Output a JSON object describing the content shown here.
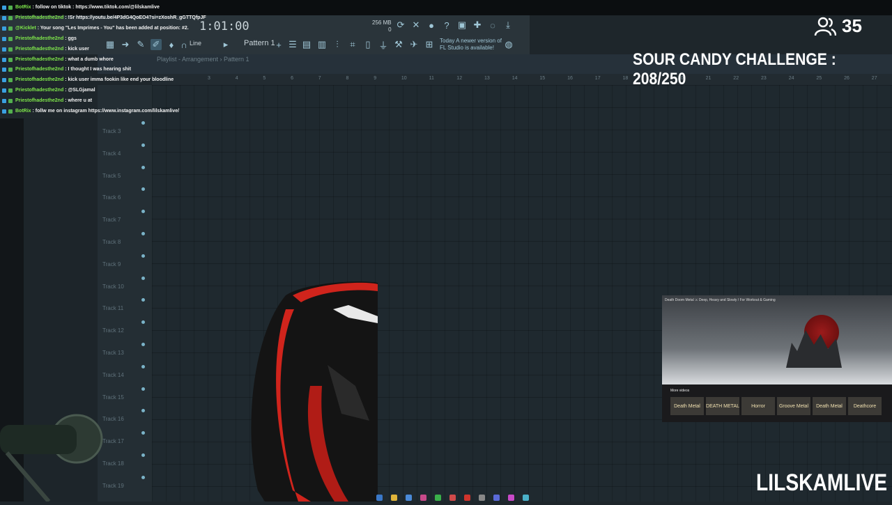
{
  "app": {
    "time": "1:01:00",
    "memory_top": "256 MB",
    "memory_bottom": "0",
    "pattern_label": "Pattern 1",
    "snap_label": "Line",
    "update_notice_line1": "Today  A newer version of",
    "update_notice_line2": "FL Studio is available!",
    "breadcrumb": "Playlist - Arrangement  ›  Pattern 1"
  },
  "ruler": [
    "3",
    "4",
    "5",
    "6",
    "7",
    "8",
    "9",
    "10",
    "11",
    "12",
    "13",
    "14",
    "15",
    "16",
    "17",
    "18",
    "19",
    "20",
    "21",
    "22",
    "23",
    "24",
    "25",
    "26",
    "27"
  ],
  "tracks": [
    "Track 3",
    "Track 4",
    "Track 5",
    "Track 6",
    "Track 7",
    "Track 8",
    "Track 9",
    "Track 10",
    "Track 11",
    "Track 12",
    "Track 13",
    "Track 14",
    "Track 15",
    "Track 16",
    "Track 17",
    "Track 18",
    "Track 19"
  ],
  "chat": [
    {
      "user": "BotRix",
      "msg": " : follow on tiktok : https://www.tiktok.com/@lilskamlive"
    },
    {
      "user": "Priestofhadesthe2nd",
      "msg": " : !Sr https://youtu.be/4P3dG4QoEO4?si=zXoshR_gGTTQfpJF"
    },
    {
      "user": "@Kicklet",
      "msg": " : Your song \"Les Imprimes - You\" has been added at position: #2."
    },
    {
      "user": "Priestofhadesthe2nd",
      "msg": " : ggs"
    },
    {
      "user": "Priestofhadesthe2nd",
      "msg": " : kick user"
    },
    {
      "user": "Priestofhadesthe2nd",
      "msg": " : what a dumb whore"
    },
    {
      "user": "Priestofhadesthe2nd",
      "msg": " : I thought I was hearing shit"
    },
    {
      "user": "Priestofhadesthe2nd",
      "msg": " : kick user imma fookin like end your bloodline"
    },
    {
      "user": "Priestofhadesthe2nd",
      "msg": " : @SLGjamal"
    },
    {
      "user": "Priestofhadesthe2nd",
      "msg": " : where u at"
    },
    {
      "user": "BotRix",
      "msg": " : follw me on instagram https://www.instagram.com/lilskamlive/"
    }
  ],
  "overlay": {
    "viewer_count": "35",
    "challenge": "SOUR CANDY CHALLENGE : 208/250",
    "brand": "LILSKAMLIVE"
  },
  "video": {
    "title": "Death Doom Metal ⚔ Deep, Heavy and Slowly / For Workout & Gaming",
    "more_label": "More videos",
    "thumbs": [
      "Death Metal",
      "DEATH METAL",
      "Horror",
      "Groove Metal",
      "Death Metal",
      "Deathcore"
    ]
  },
  "colors": {
    "chat_user": "#7ee64a",
    "accent": "#9fc6d6",
    "chair_red": "#d0241c"
  }
}
